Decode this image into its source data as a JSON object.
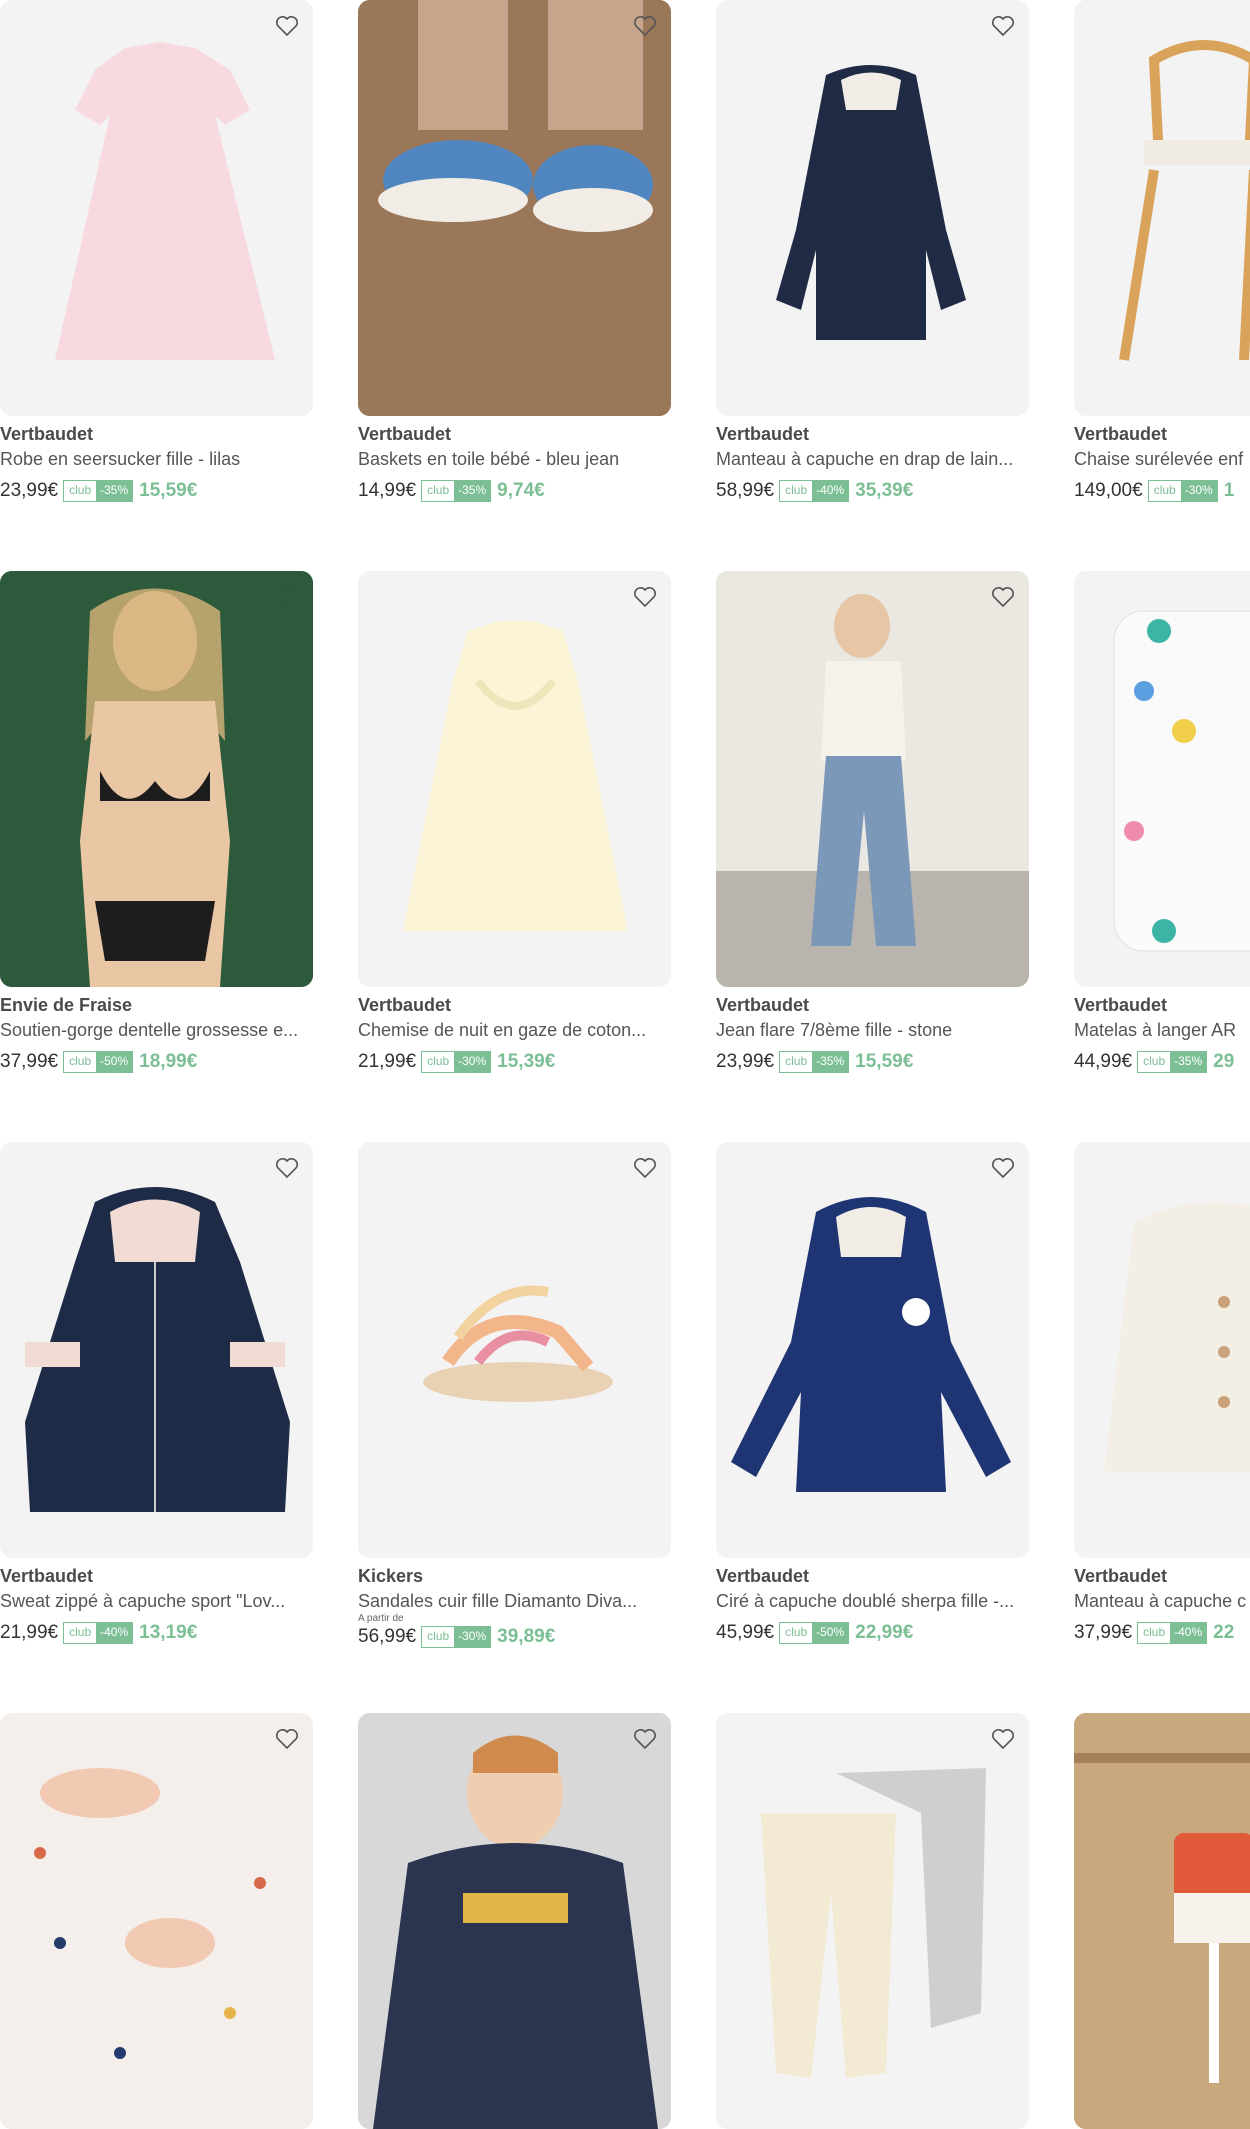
{
  "products": [
    {
      "brand": "Vertbaudet",
      "title": "Robe en seersucker fille - lilas",
      "from": "",
      "original_price": "23,99€",
      "club_label": "club",
      "discount": "-35%",
      "sale_price": "15,59€",
      "image_bg": "#f3f3f3"
    },
    {
      "brand": "Vertbaudet",
      "title": "Baskets en toile bébé - bleu jean",
      "from": "",
      "original_price": "14,99€",
      "club_label": "club",
      "discount": "-35%",
      "sale_price": "9,74€",
      "image_bg": "#8a6a52"
    },
    {
      "brand": "Vertbaudet",
      "title": "Manteau à capuche en drap de lain...",
      "from": "",
      "original_price": "58,99€",
      "club_label": "club",
      "discount": "-40%",
      "sale_price": "35,39€",
      "image_bg": "#f3f3f3"
    },
    {
      "brand": "Vertbaudet",
      "title": "Chaise surélevée enf",
      "from": "",
      "original_price": "149,00€",
      "club_label": "club",
      "discount": "-30%",
      "sale_price": "1",
      "image_bg": "#f3f3f3"
    },
    {
      "brand": "Envie de Fraise",
      "title": "Soutien-gorge dentelle grossesse e...",
      "from": "",
      "original_price": "37,99€",
      "club_label": "club",
      "discount": "-50%",
      "sale_price": "18,99€",
      "image_bg": "#2e5a3a"
    },
    {
      "brand": "Vertbaudet",
      "title": "Chemise de nuit en gaze de coton...",
      "from": "",
      "original_price": "21,99€",
      "club_label": "club",
      "discount": "-30%",
      "sale_price": "15,39€",
      "image_bg": "#f3f3f3"
    },
    {
      "brand": "Vertbaudet",
      "title": "Jean flare 7/8ème fille - stone",
      "from": "",
      "original_price": "23,99€",
      "club_label": "club",
      "discount": "-35%",
      "sale_price": "15,59€",
      "image_bg": "#e8e4de"
    },
    {
      "brand": "Vertbaudet",
      "title": "Matelas à langer AR",
      "from": "",
      "original_price": "44,99€",
      "club_label": "club",
      "discount": "-35%",
      "sale_price": "29",
      "image_bg": "#f3f3f3"
    },
    {
      "brand": "Vertbaudet",
      "title": "Sweat zippé à capuche sport \"Lov...",
      "from": "",
      "original_price": "21,99€",
      "club_label": "club",
      "discount": "-40%",
      "sale_price": "13,19€",
      "image_bg": "#f3f3f3"
    },
    {
      "brand": "Kickers",
      "title": "Sandales cuir fille Diamanto Diva...",
      "from": "A partir de",
      "original_price": "56,99€",
      "club_label": "club",
      "discount": "-30%",
      "sale_price": "39,89€",
      "image_bg": "#f3f3f3"
    },
    {
      "brand": "Vertbaudet",
      "title": "Ciré à capuche doublé sherpa fille -...",
      "from": "",
      "original_price": "45,99€",
      "club_label": "club",
      "discount": "-50%",
      "sale_price": "22,99€",
      "image_bg": "#f3f3f3"
    },
    {
      "brand": "Vertbaudet",
      "title": "Manteau à capuche c",
      "from": "",
      "original_price": "37,99€",
      "club_label": "club",
      "discount": "-40%",
      "sale_price": "22",
      "image_bg": "#f3f3f3"
    },
    {
      "brand": "",
      "title": "",
      "from": "",
      "original_price": "",
      "club_label": "",
      "discount": "",
      "sale_price": "",
      "image_bg": "#efe9e4"
    },
    {
      "brand": "",
      "title": "",
      "from": "",
      "original_price": "",
      "club_label": "",
      "discount": "",
      "sale_price": "",
      "image_bg": "#d9d9d9"
    },
    {
      "brand": "",
      "title": "",
      "from": "",
      "original_price": "",
      "club_label": "",
      "discount": "",
      "sale_price": "",
      "image_bg": "#f3f3f3"
    },
    {
      "brand": "",
      "title": "",
      "from": "",
      "original_price": "",
      "club_label": "",
      "discount": "",
      "sale_price": "",
      "image_bg": "#c9a77c"
    }
  ]
}
